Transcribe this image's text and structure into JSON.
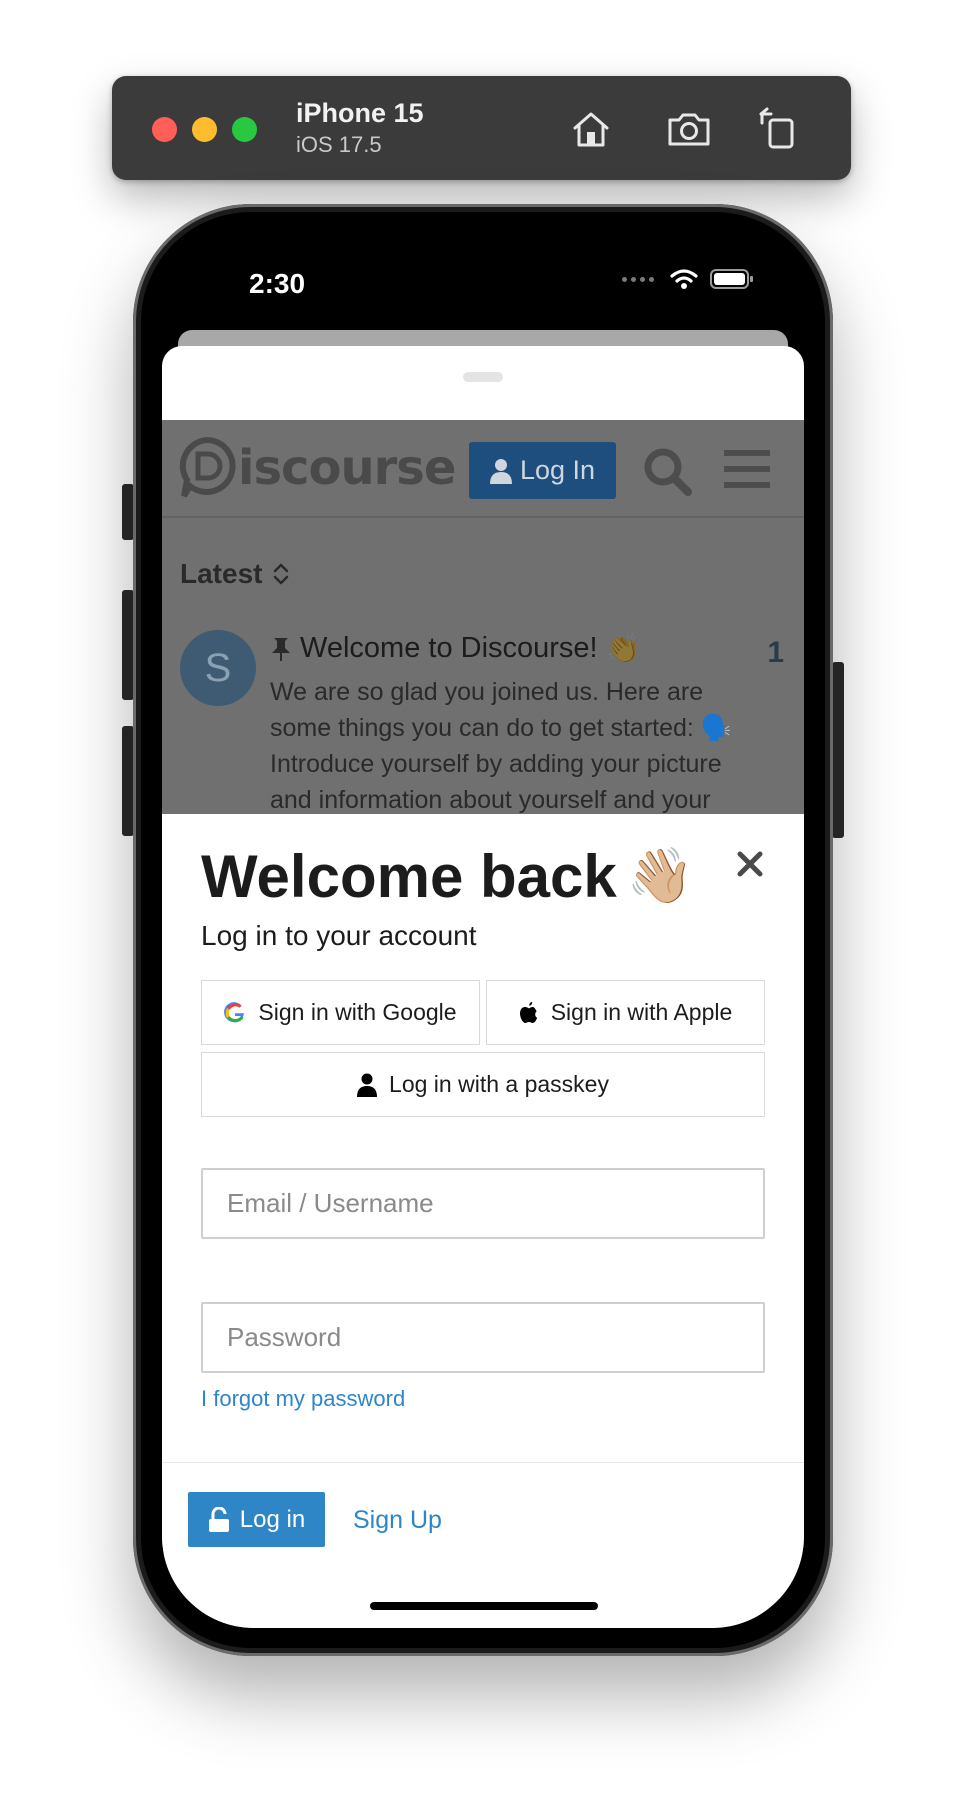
{
  "simulator": {
    "device_name": "iPhone 15",
    "os_version": "iOS 17.5",
    "buttons": [
      "home-icon",
      "screenshot-icon",
      "rotate-icon"
    ]
  },
  "status_bar": {
    "time": "2:30",
    "icons": [
      "signal-icon",
      "wifi-icon",
      "battery-icon"
    ]
  },
  "background_page": {
    "logo_text": "iscourse",
    "login_button": "Log In",
    "filter_label": "Latest",
    "topic": {
      "avatar_letter": "S",
      "title": "Welcome to Discourse!",
      "reply_count": "1",
      "excerpt": "We are so glad you joined us. Here are some things you can do to get started: 🗣️ Introduce yourself by adding your picture and information about yourself and your"
    }
  },
  "login_modal": {
    "title": "Welcome back",
    "title_emoji": "👋🏼",
    "subtitle": "Log in to your account",
    "google_button": "Sign in with Google",
    "apple_button": "Sign in with Apple",
    "passkey_button": "Log in with a passkey",
    "email_placeholder": "Email / Username",
    "password_placeholder": "Password",
    "forgot_link": "I forgot my password",
    "login_button": "Log in",
    "signup_link": "Sign Up"
  },
  "colors": {
    "accent": "#2e86c7",
    "dim_overlay": "#707070",
    "text": "#1c1c1c"
  }
}
